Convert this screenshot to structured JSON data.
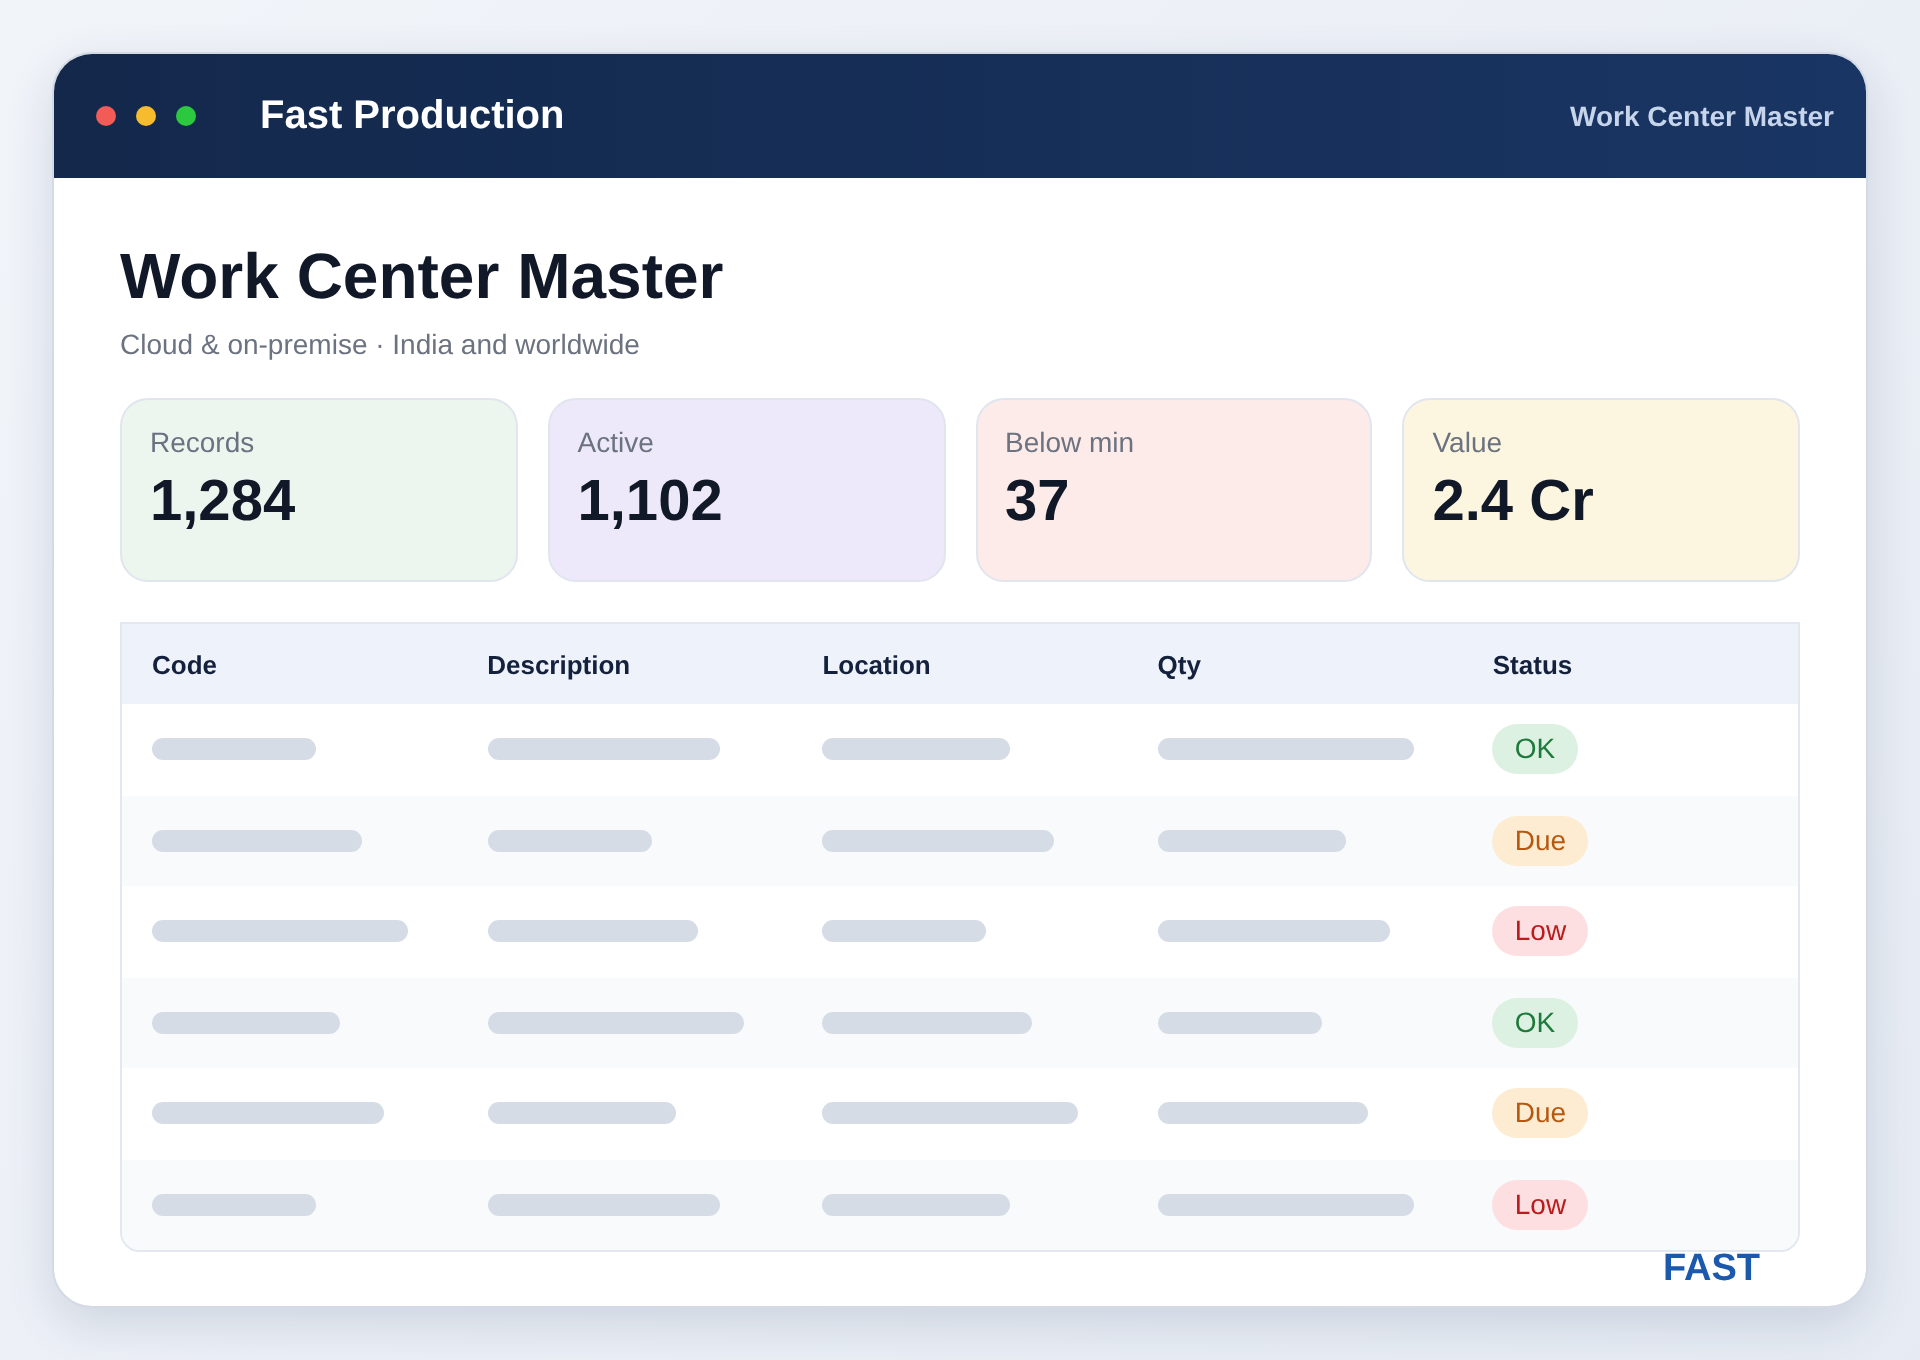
{
  "window": {
    "title": "Fast Production",
    "section": "Work Center Master"
  },
  "page": {
    "heading": "Work Center Master",
    "subtitle": "Cloud & on-premise · India and worldwide"
  },
  "stats": [
    {
      "label": "Records",
      "value": "1,284",
      "color": "#ecf5ee"
    },
    {
      "label": "Active",
      "value": "1,102",
      "color": "#ede8fa"
    },
    {
      "label": "Below min",
      "value": "37",
      "color": "#fdebea"
    },
    {
      "label": "Value",
      "value": "2.4 Cr",
      "color": "#fcf6e0"
    }
  ],
  "table": {
    "columns": [
      "Code",
      "Description",
      "Location",
      "Qty",
      "Status"
    ],
    "rows": [
      {
        "status": "OK",
        "kind": "ok"
      },
      {
        "status": "Due",
        "kind": "due"
      },
      {
        "status": "Low",
        "kind": "low"
      },
      {
        "status": "OK",
        "kind": "ok"
      },
      {
        "status": "Due",
        "kind": "due"
      },
      {
        "status": "Low",
        "kind": "low"
      }
    ]
  },
  "logo": "FAST"
}
